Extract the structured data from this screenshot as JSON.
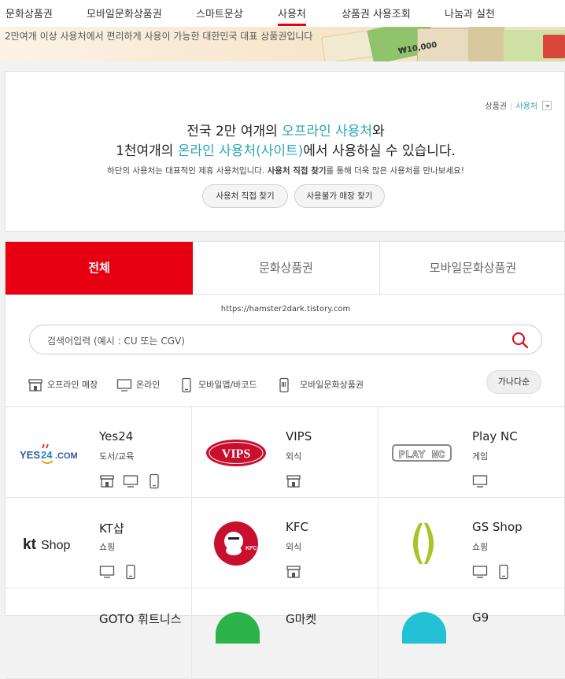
{
  "nav": {
    "items": [
      "문화상품권",
      "모바일문화상품권",
      "스마트문상",
      "사용처",
      "상품권 사용조회",
      "나눔과 실천"
    ],
    "active_index": 3
  },
  "banner": {
    "text": "2만여개 이상 사용처에서 편리하게 사용이 가능한 대한민국 대표 상품권입니다",
    "coupon_amount": "₩10,000"
  },
  "info": {
    "links": {
      "gift": "상품권",
      "place": "사용처"
    },
    "headline_line1_pre": "전국 2만 여개의 ",
    "headline_line1_hl": "오프라인 사용처",
    "headline_line1_post": "와",
    "headline_line2_pre": "1천여개의 ",
    "headline_line2_hl": "온라인 사용처(사이트)",
    "headline_line2_post": "에서 사용하실 수 있습니다.",
    "sub_pre": "하단의 사용처는 대표적인 제휴 사용처입니다. ",
    "sub_bold": "사용처 직접 찾기",
    "sub_post": "를 통해 더욱 많은 사용처를 만나보세요!",
    "btn_find": "사용처 직접 찾기",
    "btn_unavailable": "사용불가 매장 찾기"
  },
  "tabs": [
    "전체",
    "문화상품권",
    "모바일문화상품권"
  ],
  "watermark_url": "https://hamster2dark.tistory.com",
  "search": {
    "placeholder": "검색어입력 (예시 : CU 또는 CGV)"
  },
  "filters": [
    "오프라인 매장",
    "온라인",
    "모바일앱/바코드",
    "모바일문화상품권"
  ],
  "sort_label": "가나다순",
  "merchants": [
    {
      "name": "Yes24",
      "category": "도서/교육",
      "logo_text": "YES24.COM",
      "icons": [
        "store-icon",
        "monitor-icon",
        "mobile-icon"
      ]
    },
    {
      "name": "VIPS",
      "category": "외식",
      "logo_text": "VIPS",
      "icons": [
        "store-icon"
      ]
    },
    {
      "name": "Play NC",
      "category": "게임",
      "logo_text": "PLAY NC",
      "icons": [
        "monitor-icon"
      ]
    },
    {
      "name": "KT샵",
      "category": "쇼핑",
      "logo_text": "kt Shop",
      "icons": [
        "monitor-icon",
        "mobile-icon"
      ]
    },
    {
      "name": "KFC",
      "category": "외식",
      "logo_text": "KFC",
      "icons": [
        "store-icon"
      ]
    },
    {
      "name": "GS Shop",
      "category": "쇼핑",
      "logo_text": "",
      "icons": [
        "monitor-icon",
        "mobile-icon"
      ]
    },
    {
      "name": "GOTO 휘트니스",
      "category": "",
      "logo_text": "",
      "icons": []
    },
    {
      "name": "G마켓",
      "category": "",
      "logo_text": "",
      "icons": []
    },
    {
      "name": "G9",
      "category": "",
      "logo_text": "",
      "icons": []
    }
  ],
  "colors": {
    "accent": "#e60012",
    "highlight": "#2aa6b9"
  }
}
